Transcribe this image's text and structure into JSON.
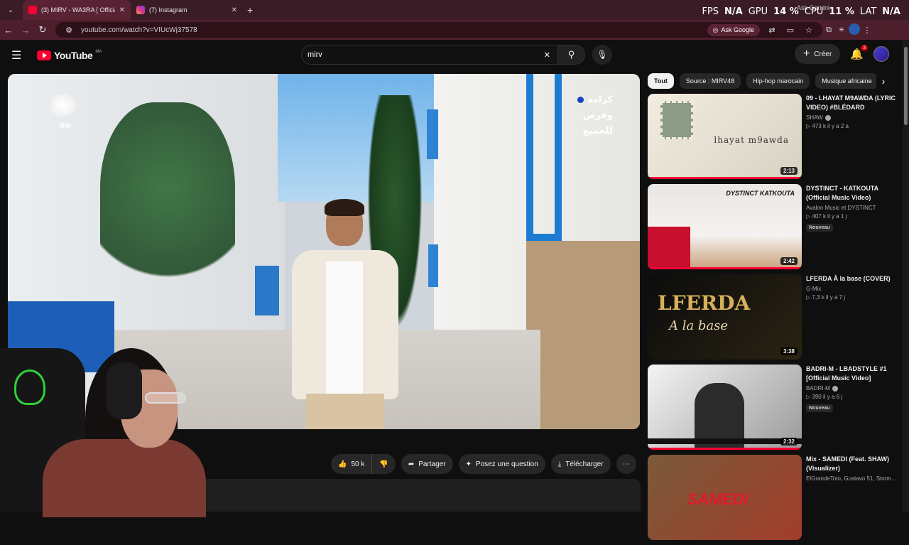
{
  "browser": {
    "tabs": [
      {
        "title": "(3) MIRV - WA3RA [ Official mu",
        "icon": "youtube-favicon"
      },
      {
        "title": "(7) Instagram",
        "icon": "instagram-favicon"
      }
    ],
    "url": "youtube.com/watch?v=VIUcWj37578",
    "ask_google": "Ask Google",
    "ask_gemini": "Ask Gemini"
  },
  "perf_overlay": {
    "fps_label": "FPS",
    "fps_value": "N/A",
    "gpu_label": "GPU",
    "gpu_value": "14 %",
    "cpu_label": "CPU",
    "cpu_value": "11 %",
    "lat_label": "LAT",
    "lat_value": "N/A"
  },
  "youtube": {
    "logo_text": "YouTube",
    "country_code": "MA",
    "search_value": "mirv",
    "create_label": "Créer",
    "notification_count": "3"
  },
  "video": {
    "watermark_left": "RNI",
    "slogan_lines": [
      "كرامة",
      "وفرص",
      "للجميع"
    ],
    "likes": "50 k",
    "share_label": "Partager",
    "ask_label": "Posez une question",
    "download_label": "Télécharger"
  },
  "chips": [
    "Tout",
    "Source : MIRV48",
    "Hip-hop marocain",
    "Musique africaine"
  ],
  "recommendations": [
    {
      "title": "09 - LHAYAT M9AWDA (LYRIC VIDEO) #BLÉDARD",
      "channel": "SHAW",
      "verified": true,
      "meta": "▷ 473 k  il y a 2 a",
      "duration": "2:13",
      "badge": "",
      "thumb_text": "lhayat m9awda"
    },
    {
      "title": "DYSTINCT - KATKOUTA (Official Music Video)",
      "channel": "Avalon Music et DYSTINCT",
      "verified": false,
      "meta": "▷ 407 k  il y a 1 j",
      "duration": "2:42",
      "badge": "Nouveau",
      "thumb_text": "DYSTINCT KATKOUTA"
    },
    {
      "title": "LFERDA  À la base (COVER)",
      "channel": "G-Mix",
      "verified": false,
      "meta": "▷ 7,3 k  il y a 7 j",
      "duration": "3:38",
      "badge": "",
      "thumb_text": "LFERDA",
      "thumb_sub": "A la base"
    },
    {
      "title": "BADRI-M - LBADSTYLE #1 [Official Music Video]",
      "channel": "BADRI-M",
      "verified": true,
      "meta": "▷ 390  il y a 6 j",
      "duration": "2:32",
      "badge": "Nouveau",
      "thumb_text": ""
    },
    {
      "title": "Mix - SAMEDI (Feat. SHAW) (Visualizer)",
      "channel": "ElGrandeToto, Gustavo 51, Storm…",
      "verified": false,
      "meta": "",
      "duration": "",
      "badge": "",
      "thumb_text": "SAMEDI"
    }
  ]
}
